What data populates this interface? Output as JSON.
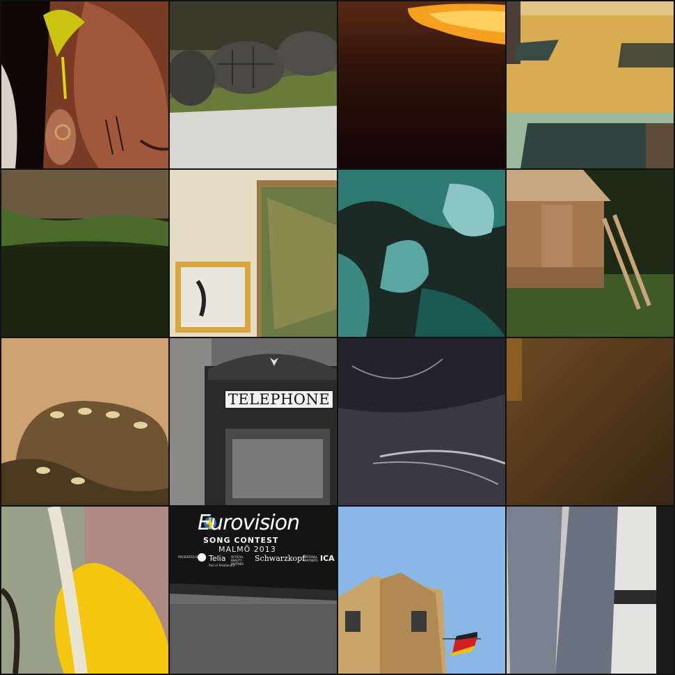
{
  "grid": {
    "rows": 4,
    "cols": 4
  },
  "tiles": [
    {
      "subject": "painted face with feather headdress"
    },
    {
      "subject": "turtles on rock"
    },
    {
      "subject": "orange glow over dark water"
    },
    {
      "subject": "yellow building rooftop"
    },
    {
      "subject": "upside-down field and trees"
    },
    {
      "subject": "framed paintings on wall"
    },
    {
      "subject": "teal coral polyps"
    },
    {
      "subject": "wooden shed on stilts"
    },
    {
      "subject": "coiled snake on sand"
    },
    {
      "subject": "telephone booth",
      "sign": "TELEPHONE"
    },
    {
      "subject": "dark feathers"
    },
    {
      "subject": "blurred brown interior"
    },
    {
      "subject": "yellow flower bud"
    },
    {
      "subject": "Eurovision car",
      "logo": "Eurovision",
      "line1": "SONG CONTEST",
      "line2": "MALMÖ 2013",
      "sponsor1": "Telia",
      "sponsor2": "Schwarzkopf",
      "sponsor3": "ICA",
      "small1": "PRESENTED BY",
      "small2": "Part of TeliaSonera",
      "small3": "OFFICIAL BEAUTY PARTNER",
      "small4": "NATIONAL PARTNERS"
    },
    {
      "subject": "tilted building with flag"
    },
    {
      "subject": "legs in grey trousers"
    }
  ]
}
